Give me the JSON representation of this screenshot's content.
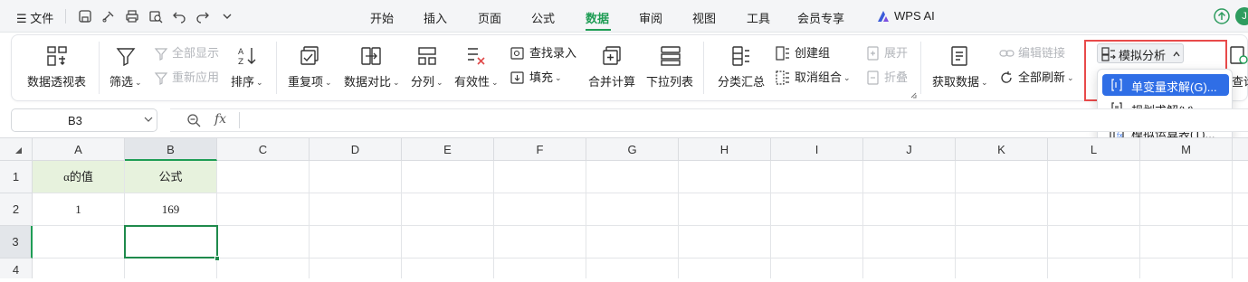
{
  "menubar": {
    "menu_label": "☰ 文件",
    "tabs": [
      "开始",
      "插入",
      "页面",
      "公式",
      "数据",
      "审阅",
      "视图",
      "工具",
      "会员专享"
    ],
    "active_tab": "数据",
    "wps_ai": "WPS AI",
    "avatar_letter": "J"
  },
  "ribbon": {
    "pivot": "数据透视表",
    "filter": "筛选",
    "show_all": "全部显示",
    "reapply": "重新应用",
    "sort": "排序",
    "duplicates": "重复项",
    "compare": "数据对比",
    "split": "分列",
    "validity": "有效性",
    "find_entry": "查找录入",
    "fill": "填充",
    "consolidate": "合并计算",
    "dropdown_list": "下拉列表",
    "subtotal": "分类汇总",
    "create_group": "创建组",
    "ungroup": "取消组合",
    "expand": "展开",
    "collapse": "折叠",
    "get_data": "获取数据",
    "edit_links": "编辑链接",
    "refresh_all": "全部刷新",
    "what_if": "模拟分析",
    "query": "查询"
  },
  "dropdown": {
    "items": [
      "单变量求解(G)...",
      "规划求解(V)...",
      "模拟运算表(T)..."
    ],
    "active_index": 0
  },
  "formula_bar": {
    "name_box": "B3",
    "fx": "fx",
    "content": ""
  },
  "sheet": {
    "columns": [
      "A",
      "B",
      "C",
      "D",
      "E",
      "F",
      "G",
      "H",
      "I",
      "J",
      "K",
      "L",
      "M"
    ],
    "rows": [
      "1",
      "2",
      "3",
      "4"
    ],
    "selected_cell": "B3",
    "cells": {
      "A1": "α的值",
      "B1": "公式",
      "A2": "1",
      "B2": "169"
    }
  },
  "colors": {
    "accent": "#1f9d55",
    "header_fill": "#e7f2dd",
    "highlight_border": "#e84a4a",
    "dropdown_active": "#2f6ee6"
  }
}
